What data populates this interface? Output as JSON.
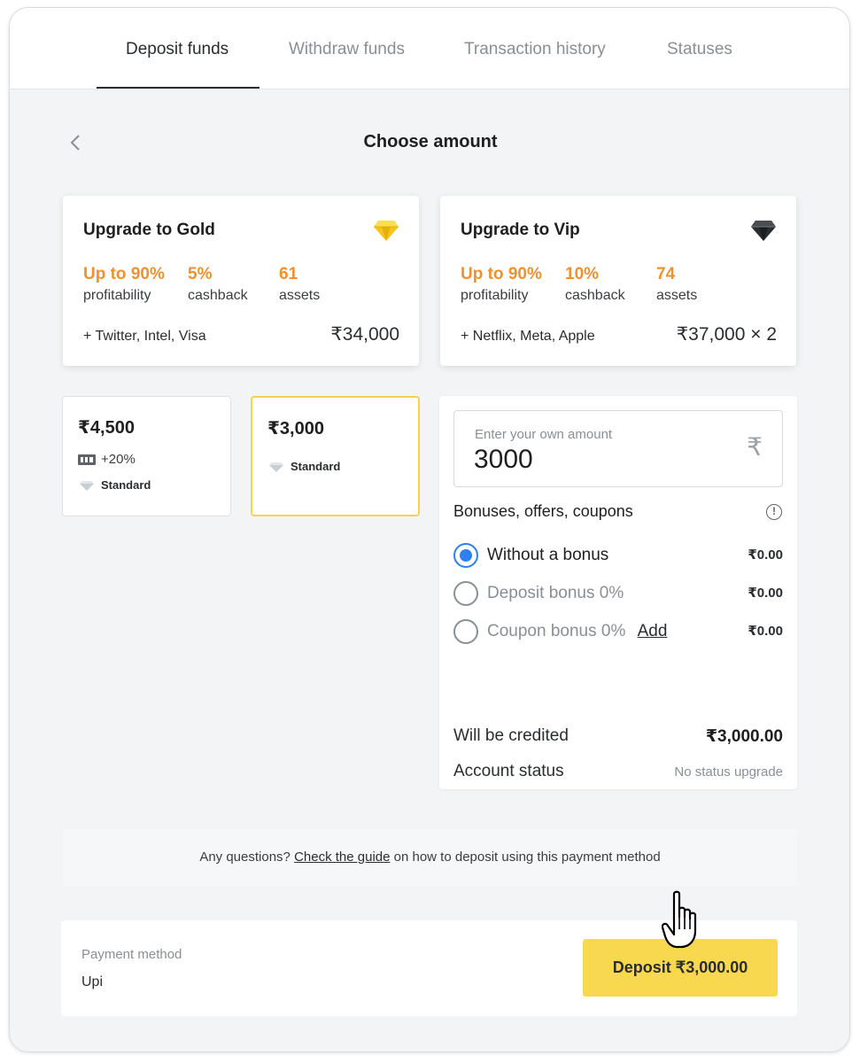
{
  "tabs": [
    {
      "label": "Deposit funds",
      "active": true
    },
    {
      "label": "Withdraw funds",
      "active": false
    },
    {
      "label": "Transaction history",
      "active": false
    },
    {
      "label": "Statuses",
      "active": false
    }
  ],
  "page": {
    "title": "Choose amount",
    "back_icon": "chevron-left-icon"
  },
  "upgrade_cards": [
    {
      "title": "Upgrade to Gold",
      "gem_icon": "gold-diamond-icon",
      "gem_color": "#f5c518",
      "stats": [
        {
          "value": "Up to 90%",
          "label": "profitability"
        },
        {
          "value": "5%",
          "label": "cashback"
        },
        {
          "value": "61",
          "label": "assets"
        }
      ],
      "brands": "+ Twitter, Intel, Visa",
      "price": "₹34,000"
    },
    {
      "title": "Upgrade to Vip",
      "gem_icon": "black-diamond-icon",
      "gem_color": "#2a2d30",
      "stats": [
        {
          "value": "Up to 90%",
          "label": "profitability"
        },
        {
          "value": "10%",
          "label": "cashback"
        },
        {
          "value": "74",
          "label": "assets"
        }
      ],
      "brands": "+ Netflix, Meta, Apple",
      "price": "₹37,000 × 2"
    }
  ],
  "amount_options": [
    {
      "value": "₹4,500",
      "bonus": "+20%",
      "bonus_icon": "ticket-icon",
      "tier": "Standard",
      "selected": false
    },
    {
      "value": "₹3,000",
      "tier": "Standard",
      "selected": true
    }
  ],
  "amount_input": {
    "label": "Enter your own amount",
    "value": "3000",
    "currency_icon": "rupee-icon",
    "currency_symbol": "₹"
  },
  "bonuses": {
    "title": "Bonuses, offers, coupons",
    "info_icon": "info-icon",
    "options": [
      {
        "label": "Without a bonus",
        "amount": "₹0.00",
        "checked": true
      },
      {
        "label": "Deposit bonus 0%",
        "amount": "₹0.00",
        "checked": false
      },
      {
        "label": "Coupon bonus 0%",
        "link": "Add",
        "amount": "₹0.00",
        "checked": false
      }
    ]
  },
  "summary": {
    "credited_label": "Will be credited",
    "credited_value": "₹3,000.00",
    "status_label": "Account status",
    "status_value": "No status upgrade"
  },
  "help": {
    "prefix": "Any questions?",
    "link": "Check the guide",
    "suffix": "on how to deposit using this payment method"
  },
  "payment": {
    "label": "Payment method",
    "value": "Upi",
    "deposit_button": "Deposit ₹3,000.00"
  },
  "colors": {
    "accent_yellow": "#f7d84e",
    "stat_orange": "#f0912e",
    "radio_blue": "#2f7ff0"
  }
}
